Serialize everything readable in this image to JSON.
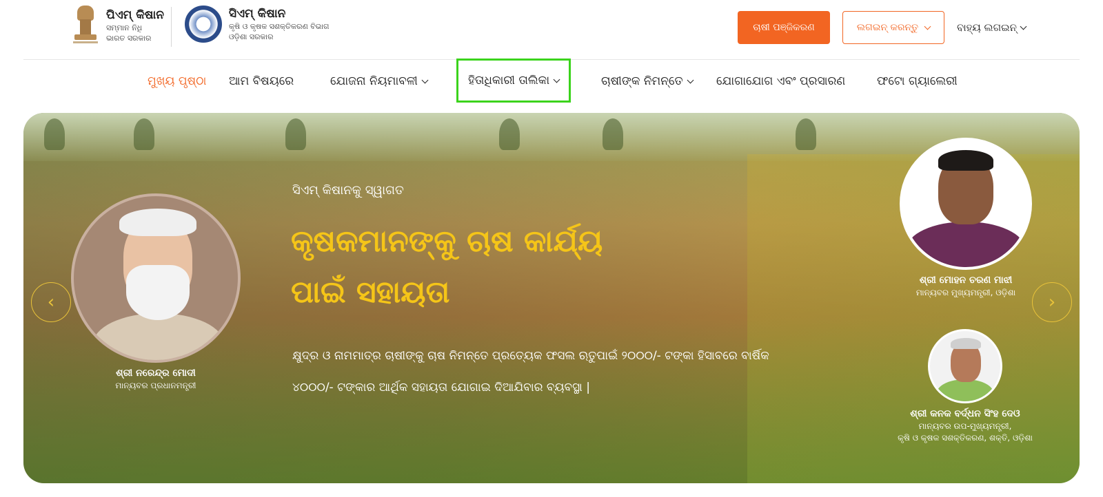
{
  "header": {
    "logo1": {
      "title": "ପିଏମ୍ କିଷାନ",
      "line1": "ସମ୍ମାନ ନିଧି",
      "line2": "ଭାରତ ସରକାର"
    },
    "logo2": {
      "title": "ସିଏମ୍ କିଷାନ",
      "line1": "କୃଷି ଓ କୃଷକ ସଶକ୍ତିକରଣ ବିଭାଗ",
      "line2": "ଓଡ଼ିଶା ସରକାର"
    },
    "register_label": "ଚାଷୀ ପଞ୍ଜିକରଣ",
    "login_label": "ଲଗଇନ୍ କରନ୍ତୁ",
    "external_login_label": "ବାହ୍ୟ ଲଗଇନ୍"
  },
  "nav": {
    "home": "ମୁଖ୍ୟ ପୃଷ୍ଠା",
    "about": "ଆମ ବିଷୟରେ",
    "scheme_rules": "ଯୋଜନା ନିୟମାବଳୀ",
    "beneficiary_list": "ହିତାଧିକାରୀ ତାଲିକା",
    "for_farmers": "ଚାଷୀଙ୍କ ନିମନ୍ତେ",
    "contact": "ଯୋଗାଯୋଗ ଏବଂ ପ୍ରସାରଣ",
    "gallery": "ଫଟୋ ଗ୍ୟାଲେରୀ"
  },
  "banner": {
    "welcome": "ସିଏମ୍ କିଷାନକୁ ସ୍ୱାଗତ",
    "headline_line1": "କୃଷକମାନଙ୍କୁ ଚାଷ କାର୍ଯ୍ୟ",
    "headline_line2": "ପାଇଁ ସହାୟତା",
    "description": "କ୍ଷୁଦ୍ର ଓ ନାମମାତ୍ର ଚାଷୀଙ୍କୁ ଚାଷ ନିମନ୍ତେ ପ୍ରତ୍ୟେକ ଫସଲ ଋତୁପାଇଁ ୨୦୦୦/- ଟଙ୍କା ହିସାବରେ ବାର୍ଷିକ ୪୦୦୦/- ଟଙ୍କାର ଆର୍ଥିକ ସହାୟତା ଯୋଗାଇ ଦିଆଯିବାର ବ୍ୟବସ୍ଥା |",
    "pm": {
      "name": "ଶ୍ରୀ ନରେନ୍ଦ୍ର ମୋଦୀ",
      "role": "ମାନ୍ୟବର ପ୍ରଧାନମନ୍ତ୍ରୀ"
    },
    "cm": {
      "name": "ଶ୍ରୀ ମୋହନ ଚରଣ ମାଝୀ",
      "role": "ମାନ୍ୟବର ମୁଖ୍ୟମନ୍ତ୍ରୀ, ଓଡ଼ିଶା"
    },
    "dcm": {
      "name": "ଶ୍ରୀ କନକ ବର୍ଦ୍ଧନ ସିଂହ ଦେଓ",
      "role_line1": "ମାନ୍ୟବର ଉପ-ମୁଖ୍ୟମନ୍ତ୍ରୀ,",
      "role_line2": "କୃଷି ଓ କୃଷକ ସଶକ୍ତିକରଣ, ଶକ୍ତି, ଓଡ଼ିଶା"
    },
    "prev_icon": "‹",
    "next_icon": "›"
  },
  "colors": {
    "accent": "#f26522",
    "headline": "#f5c518",
    "highlight_box": "#3bd31c"
  }
}
